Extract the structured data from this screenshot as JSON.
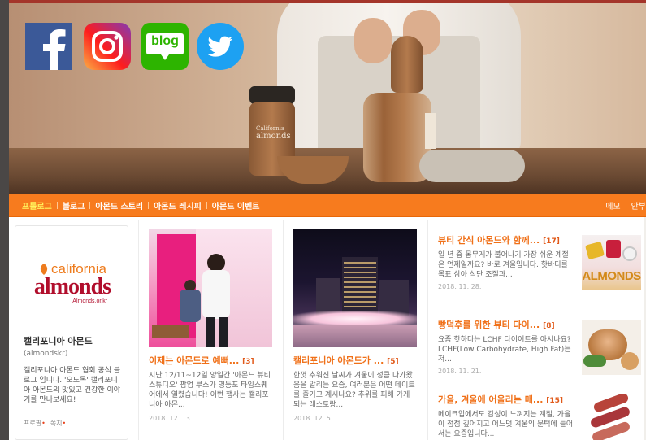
{
  "social": [
    {
      "name": "facebook",
      "icon": "facebook-icon",
      "color": "#3b5998"
    },
    {
      "name": "instagram",
      "icon": "instagram-icon",
      "color": "#c13584"
    },
    {
      "name": "blog",
      "icon": "blog-icon",
      "label": "blog",
      "color": "#2db400"
    },
    {
      "name": "twitter",
      "icon": "twitter-icon",
      "color": "#1da1f2"
    }
  ],
  "banner": {
    "jar_label_line1": "California",
    "jar_label_line2": "almonds"
  },
  "nav": {
    "items": [
      "프롤로그",
      "블로그",
      "아몬드 스토리",
      "아몬드 레시피",
      "아몬드 이벤트"
    ],
    "right": [
      "메모",
      "안부"
    ],
    "accent": "#f77b1e",
    "active_color": "#fff45d"
  },
  "profile": {
    "logo_line1": "california",
    "logo_line2": "almonds",
    "logo_url": "Almonds.or.kr",
    "name": "캘리포니아 아몬드",
    "handle": "(almondskr)",
    "description": "캘리포니아 아몬드 협회 공식 블로그 입니다. '오도독' 캘리포니아 아몬드의 맛있고 건강한 이야기를 만나보세요!",
    "link_profile": "프로필",
    "link_follow": "쪽지"
  },
  "cards": [
    {
      "title": "이제는 아몬드로 예뻐...",
      "count": "[3]",
      "excerpt": "지난 12/11~12일 양일간 '아몬드 뷰티 스튜디오' 팝업 부스가 영등포 타임스퀘어에서 열렸습니다! 이번 행사는 캘리포니아 아몬...",
      "date": "2018. 12. 13."
    },
    {
      "title": "캘리포니아 아몬드가 ...",
      "count": "[5]",
      "excerpt": "한껏 추워진 날씨가 겨울이 성큼 다가왔음을 알리는 요즘, 여러분은 어떤 데이트를 즐기고 계시나요? 추위를 피해 가게 되는 레스토랑...",
      "date": "2018. 12. 5."
    }
  ],
  "list": [
    {
      "title": "뷰티 간식 아몬드와 함께...",
      "count": "[17]",
      "text": "일 년 중 몸무게가 불어나기 가장 쉬운 계절은 언제일까요? 바로 겨울입니다. 핫바디를 목표 삼아 식단 조절과...",
      "date": "2018. 11. 28."
    },
    {
      "title": "빵덕후를 위한 뷰티 다이...",
      "count": "[8]",
      "text": "요즘 핫하다는 LCHF 다이어트를 아시나요? LCHF(Low Carbohydrate, High Fat)는 저...",
      "date": "2018. 11. 21."
    },
    {
      "title": "가을, 겨울에 어울리는 매...",
      "count": "[15]",
      "text": "메이크업에서도 감성이 느껴지는 계절, 가을이 점점 깊어지고 어느덧 겨울의 문턱에 들어서는 요즘입니다...",
      "date": ""
    }
  ],
  "list_pic_label": "ALMONDS"
}
